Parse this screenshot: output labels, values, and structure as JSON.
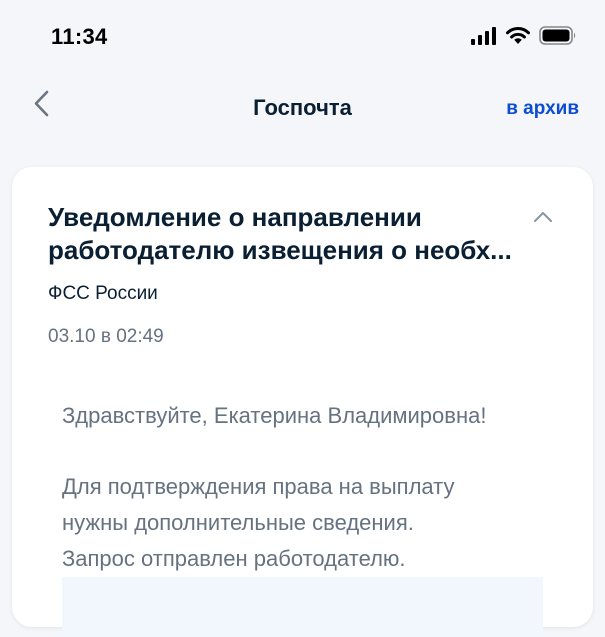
{
  "status_bar": {
    "time": "11:34",
    "icons": [
      "cellular-signal-icon",
      "wifi-icon",
      "battery-icon"
    ]
  },
  "header": {
    "back_icon": "chevron-left-icon",
    "title": "Госпочта",
    "archive_label": "в архив"
  },
  "message": {
    "title_lines": [
      "Уведомление о направлении",
      "работодателю извещения о необх..."
    ],
    "collapse_icon": "chevron-up-icon",
    "sender": "ФСС России",
    "date": "03.10 в 02:49",
    "greeting": "Здравствуйте, Екатерина Владимировна!",
    "body_lines": [
      "Для подтверждения права на выплату",
      "нужны дополнительные сведения.",
      "Запрос отправлен работодателю."
    ]
  },
  "colors": {
    "background": "#f4f6f9",
    "card": "#ffffff",
    "accent": "#0d4cd3",
    "text_primary": "#0b1f33",
    "text_secondary": "#66727f",
    "info_block": "#f2f6fd"
  }
}
